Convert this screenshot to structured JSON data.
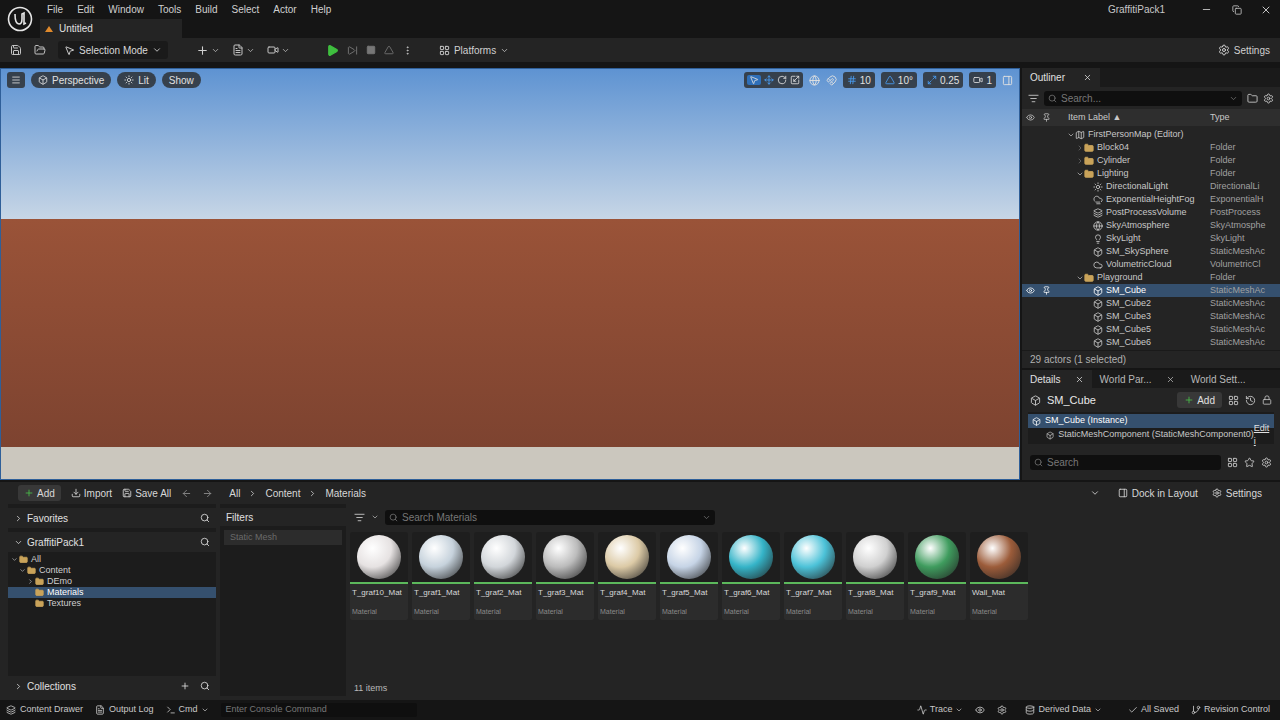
{
  "app": {
    "project": "GraffitiPack1",
    "menu": [
      "File",
      "Edit",
      "Window",
      "Tools",
      "Build",
      "Select",
      "Actor",
      "Help"
    ],
    "tabs": [
      {
        "label": "Untitled",
        "selected": true
      }
    ]
  },
  "toolbar": {
    "mode": "Selection Mode",
    "platforms": "Platforms",
    "settings": "Settings"
  },
  "viewport": {
    "view": "Perspective",
    "lighting": "Lit",
    "show": "Show",
    "grid_snap": "10",
    "rotation_snap": "10°",
    "scale_snap": "0.25",
    "camera_speed": "1"
  },
  "outliner": {
    "title": "Outliner",
    "search": {
      "placeholder": "Search..."
    },
    "columns": [
      {
        "label": "Item Label",
        "sort": "▲"
      },
      {
        "label": "Type",
        "sort": ""
      }
    ],
    "rows": [
      {
        "label": "FirstPersonMap (Editor)",
        "type": "",
        "depth": 0,
        "kind": "level",
        "expanded": true,
        "selected": false
      },
      {
        "label": "Block04",
        "type": "Folder",
        "depth": 1,
        "kind": "folder",
        "expanded": false,
        "selected": false
      },
      {
        "label": "Cylinder",
        "type": "Folder",
        "depth": 1,
        "kind": "folder",
        "expanded": false,
        "selected": false
      },
      {
        "label": "Lighting",
        "type": "Folder",
        "depth": 1,
        "kind": "folder",
        "expanded": true,
        "selected": false
      },
      {
        "label": "DirectionalLight",
        "type": "DirectionalLi",
        "depth": 2,
        "kind": "sun",
        "expanded": false,
        "selected": false
      },
      {
        "label": "ExponentialHeightFog",
        "type": "ExponentialH",
        "depth": 2,
        "kind": "fog",
        "expanded": false,
        "selected": false
      },
      {
        "label": "PostProcessVolume",
        "type": "PostProcess",
        "depth": 2,
        "kind": "volume",
        "expanded": false,
        "selected": false
      },
      {
        "label": "SkyAtmosphere",
        "type": "SkyAtmosphe",
        "depth": 2,
        "kind": "sky",
        "expanded": false,
        "selected": false
      },
      {
        "label": "SkyLight",
        "type": "SkyLight",
        "depth": 2,
        "kind": "light",
        "expanded": false,
        "selected": false
      },
      {
        "label": "SM_SkySphere",
        "type": "StaticMeshAc",
        "depth": 2,
        "kind": "mesh",
        "expanded": false,
        "selected": false
      },
      {
        "label": "VolumetricCloud",
        "type": "VolumetricCl",
        "depth": 2,
        "kind": "cloud",
        "expanded": false,
        "selected": false
      },
      {
        "label": "Playground",
        "type": "Folder",
        "depth": 1,
        "kind": "folder",
        "expanded": true,
        "selected": false
      },
      {
        "label": "SM_Cube",
        "type": "StaticMeshAc",
        "depth": 2,
        "kind": "mesh",
        "expanded": false,
        "selected": true
      },
      {
        "label": "SM_Cube2",
        "type": "StaticMeshAc",
        "depth": 2,
        "kind": "mesh",
        "expanded": false,
        "selected": false
      },
      {
        "label": "SM_Cube3",
        "type": "StaticMeshAc",
        "depth": 2,
        "kind": "mesh",
        "expanded": false,
        "selected": false
      },
      {
        "label": "SM_Cube5",
        "type": "StaticMeshAc",
        "depth": 2,
        "kind": "mesh",
        "expanded": false,
        "selected": false
      },
      {
        "label": "SM_Cube6",
        "type": "StaticMeshAc",
        "depth": 2,
        "kind": "mesh",
        "expanded": false,
        "selected": false
      }
    ],
    "footer": "29 actors (1 selected)"
  },
  "details": {
    "tabs": [
      {
        "label": "Details",
        "selected": true,
        "closable": true
      },
      {
        "label": "World Par...",
        "selected": false,
        "closable": true
      },
      {
        "label": "World Sett...",
        "selected": false,
        "closable": false
      }
    ],
    "actor": "SM_Cube",
    "add": "Add",
    "components": [
      {
        "label": "SM_Cube (Instance)",
        "selected": true,
        "action": ""
      },
      {
        "label": "StaticMeshComponent (StaticMeshComponent0)",
        "selected": false,
        "action": "Edit i"
      }
    ],
    "search": {
      "placeholder": "Search"
    }
  },
  "content_drawer": {
    "add": "Add",
    "import": "Import",
    "save_all": "Save All",
    "breadcrumb": [
      "All",
      "Content",
      "Materials"
    ],
    "dock": "Dock in Layout",
    "settings": "Settings",
    "sources": {
      "favorites": "Favorites",
      "project": "GraffitiPack1",
      "tree": [
        {
          "label": "All",
          "depth": 0,
          "expandable": true,
          "expanded": true,
          "selected": false
        },
        {
          "label": "Content",
          "depth": 1,
          "expandable": true,
          "expanded": true,
          "selected": false
        },
        {
          "label": "DEmo",
          "depth": 2,
          "expandable": true,
          "expanded": false,
          "selected": false
        },
        {
          "label": "Materials",
          "depth": 2,
          "expandable": false,
          "expanded": false,
          "selected": true
        },
        {
          "label": "Textures",
          "depth": 2,
          "expandable": false,
          "expanded": false,
          "selected": false
        }
      ],
      "collections": "Collections"
    },
    "filters": {
      "title": "Filters",
      "chips": [
        "Static Mesh"
      ]
    },
    "search": {
      "placeholder": "Search Materials"
    },
    "assets": [
      {
        "name": "T_graf10_Mat",
        "type": "Material",
        "color": "#e6e2e2"
      },
      {
        "name": "T_graf1_Mat",
        "type": "Material",
        "color": "#c6d2dc"
      },
      {
        "name": "T_graf2_Mat",
        "type": "Material",
        "color": "#d2d6da"
      },
      {
        "name": "T_graf3_Mat",
        "type": "Material",
        "color": "#bcbcbc"
      },
      {
        "name": "T_graf4_Mat",
        "type": "Material",
        "color": "#dccaa6"
      },
      {
        "name": "T_graf5_Mat",
        "type": "Material",
        "color": "#c6d4e6"
      },
      {
        "name": "T_graf6_Mat",
        "type": "Material",
        "color": "#35b4c8"
      },
      {
        "name": "T_graf7_Mat",
        "type": "Material",
        "color": "#4cc2d8"
      },
      {
        "name": "T_graf8_Mat",
        "type": "Material",
        "color": "#d0d0d0"
      },
      {
        "name": "T_graf9_Mat",
        "type": "Material",
        "color": "#3f9c5e"
      },
      {
        "name": "Wall_Mat",
        "type": "Material",
        "color": "#9c5c3a"
      }
    ],
    "count": "11 items"
  },
  "status_bar": {
    "left": [
      "Content Drawer",
      "Output Log"
    ],
    "cmd": "Cmd",
    "console": {
      "placeholder": "Enter Console Command"
    },
    "trace": "Trace",
    "derived_data": "Derived Data",
    "saved": "All Saved",
    "revision_control": "Revision Control"
  }
}
